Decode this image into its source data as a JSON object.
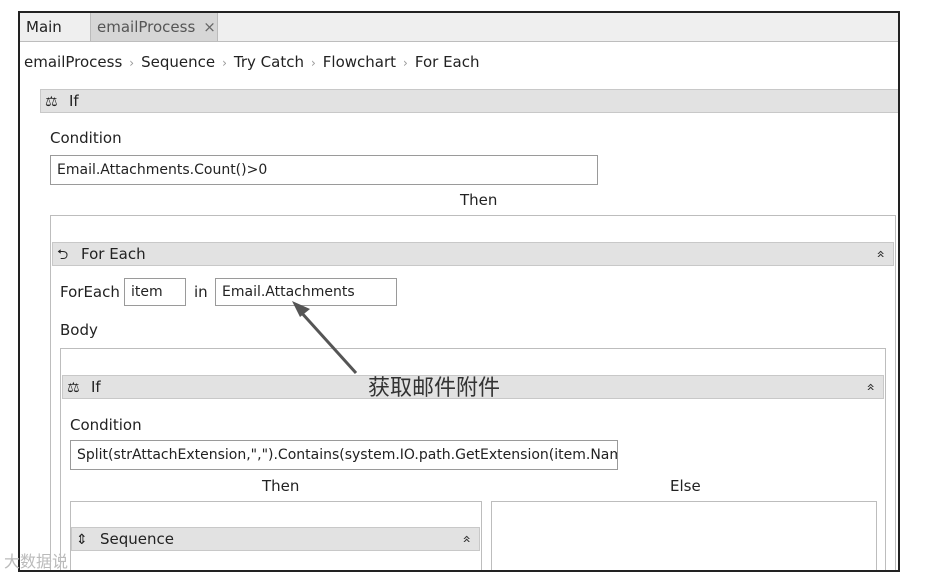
{
  "tabs": [
    {
      "label": "Main"
    },
    {
      "label": "emailProcess",
      "close": "×"
    }
  ],
  "breadcrumb": [
    "emailProcess",
    "Sequence",
    "Try Catch",
    "Flowchart",
    "For Each"
  ],
  "breadcrumb_sep": "›",
  "if_outer": {
    "title": "If",
    "condition_label": "Condition",
    "condition_value": "Email.Attachments.Count()>0",
    "then_label": "Then"
  },
  "foreach": {
    "title": "For Each",
    "foreach_label": "ForEach",
    "item_value": "item",
    "in_label": "in",
    "collection_value": "Email.Attachments",
    "body_label": "Body",
    "collapse": "«"
  },
  "annotation": "获取邮件附件",
  "if_inner": {
    "title": "If",
    "condition_label": "Condition",
    "condition_value": "Split(strAttachExtension,\",\").Contains(system.IO.path.GetExtension(item.Name",
    "then_label": "Then",
    "else_label": "Else",
    "collapse": "«"
  },
  "sequence": {
    "title": "Sequence",
    "collapse": "«"
  },
  "watermark": "大数据说"
}
